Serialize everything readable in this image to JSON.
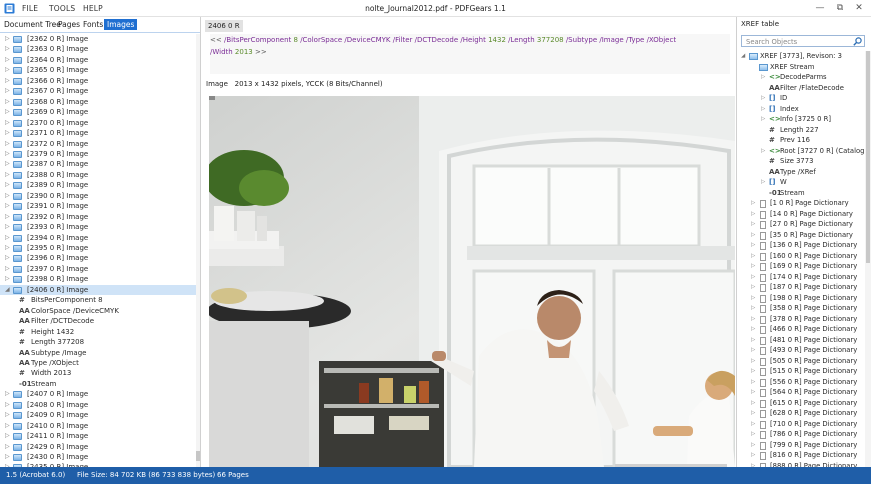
{
  "window": {
    "title": "nolte_Journal2012.pdf - PDFGears 1.1",
    "menus": [
      "FILE",
      "TOOLS",
      "HELP"
    ]
  },
  "left": {
    "tabs": [
      "Document Tree",
      "Pages",
      "Fonts",
      "Images"
    ],
    "rows": [
      {
        "label": "[2362 0 R] Image"
      },
      {
        "label": "[2363 0 R] Image"
      },
      {
        "label": "[2364 0 R] Image"
      },
      {
        "label": "[2365 0 R] Image"
      },
      {
        "label": "[2366 0 R] Image"
      },
      {
        "label": "[2367 0 R] Image"
      },
      {
        "label": "[2368 0 R] Image"
      },
      {
        "label": "[2369 0 R] Image"
      },
      {
        "label": "[2370 0 R] Image"
      },
      {
        "label": "[2371 0 R] Image"
      },
      {
        "label": "[2372 0 R] Image"
      },
      {
        "label": "[2379 0 R] Image"
      },
      {
        "label": "[2387 0 R] Image"
      },
      {
        "label": "[2388 0 R] Image"
      },
      {
        "label": "[2389 0 R] Image"
      },
      {
        "label": "[2390 0 R] Image"
      },
      {
        "label": "[2391 0 R] Image"
      },
      {
        "label": "[2392 0 R] Image"
      },
      {
        "label": "[2393 0 R] Image"
      },
      {
        "label": "[2394 0 R] Image"
      },
      {
        "label": "[2395 0 R] Image"
      },
      {
        "label": "[2396 0 R] Image"
      },
      {
        "label": "[2397 0 R] Image"
      },
      {
        "label": "[2398 0 R] Image"
      },
      {
        "label": "[2406 0 R] Image",
        "selected": true,
        "expanded": true
      },
      {
        "label": "BitsPerComponent 8",
        "icon": "#",
        "sub": true
      },
      {
        "label": "ColorSpace /DeviceCMYK",
        "icon": "AA",
        "sub": true
      },
      {
        "label": "Filter /DCTDecode",
        "icon": "AA",
        "sub": true
      },
      {
        "label": "Height 1432",
        "icon": "#",
        "sub": true
      },
      {
        "label": "Length 377208",
        "icon": "#",
        "sub": true
      },
      {
        "label": "Subtype /Image",
        "icon": "AA",
        "sub": true
      },
      {
        "label": "Type /XObject",
        "icon": "AA",
        "sub": true
      },
      {
        "label": "Width 2013",
        "icon": "#",
        "sub": true
      },
      {
        "label": "Stream",
        "icon": "-01",
        "sub": true
      },
      {
        "label": "[2407 0 R] Image"
      },
      {
        "label": "[2408 0 R] Image"
      },
      {
        "label": "[2409 0 R] Image"
      },
      {
        "label": "[2410 0 R] Image"
      },
      {
        "label": "[2411 0 R] Image"
      },
      {
        "label": "[2429 0 R] Image"
      },
      {
        "label": "[2430 0 R] Image"
      },
      {
        "label": "[2435 0 R] Image"
      }
    ]
  },
  "main": {
    "tab": "2406 0 R",
    "dict_parts": [
      {
        "t": "<< ",
        "c": "p"
      },
      {
        "t": "/BitsPerComponent ",
        "c": "k"
      },
      {
        "t": "8 ",
        "c": "n"
      },
      {
        "t": "/ColorSpace ",
        "c": "k"
      },
      {
        "t": "/DeviceCMYK ",
        "c": "k"
      },
      {
        "t": "/Filter ",
        "c": "k"
      },
      {
        "t": "/DCTDecode ",
        "c": "k"
      },
      {
        "t": "/Height ",
        "c": "k"
      },
      {
        "t": "1432 ",
        "c": "n"
      },
      {
        "t": "/Length ",
        "c": "k"
      },
      {
        "t": "377208 ",
        "c": "n"
      },
      {
        "t": "/Subtype ",
        "c": "k"
      },
      {
        "t": "/Image ",
        "c": "k"
      },
      {
        "t": "/Type ",
        "c": "k"
      },
      {
        "t": "/XObject",
        "c": "k"
      },
      {
        "t": "BR"
      },
      {
        "t": "/Width ",
        "c": "k"
      },
      {
        "t": "2013 ",
        "c": "n"
      },
      {
        "t": ">>",
        "c": "p"
      }
    ],
    "image_info_label": "Image",
    "image_info": "2013 x 1432 pixels, YCCK (8 Bits/Channel)"
  },
  "right": {
    "title": "XREF table",
    "search_placeholder": "Search Objects",
    "rows": [
      {
        "label": "XREF [3773], Revison: 3",
        "ind": 0,
        "icon": "table",
        "exp": "◢"
      },
      {
        "label": "XREF Stream",
        "ind": 1,
        "icon": "table"
      },
      {
        "label": "DecodeParms",
        "ind": 2,
        "icon": "<>",
        "exp": "▷"
      },
      {
        "label": "Filter /FlateDecode",
        "ind": 2,
        "icon": "AA"
      },
      {
        "label": "ID",
        "ind": 2,
        "icon": "[]",
        "exp": "▷"
      },
      {
        "label": "Index",
        "ind": 2,
        "icon": "[]",
        "exp": "▷"
      },
      {
        "label": "Info [3725 0 R]",
        "ind": 2,
        "icon": "<>",
        "exp": "▷"
      },
      {
        "label": "Length 227",
        "ind": 2,
        "icon": "#"
      },
      {
        "label": "Prev 116",
        "ind": 2,
        "icon": "#"
      },
      {
        "label": "Root [3727 0 R]  (Catalog)",
        "ind": 2,
        "icon": "<>",
        "exp": "▷"
      },
      {
        "label": "Size 3773",
        "ind": 2,
        "icon": "#"
      },
      {
        "label": "Type /XRef",
        "ind": 2,
        "icon": "AA"
      },
      {
        "label": "W",
        "ind": 2,
        "icon": "[]",
        "exp": "▷"
      },
      {
        "label": "Stream",
        "ind": 2,
        "icon": "-01"
      },
      {
        "label": "[1 0 R] Page Dictionary",
        "ind": 1,
        "icon": "page",
        "exp": "▷"
      },
      {
        "label": "[14 0 R] Page Dictionary",
        "ind": 1,
        "icon": "page",
        "exp": "▷"
      },
      {
        "label": "[27 0 R] Page Dictionary",
        "ind": 1,
        "icon": "page",
        "exp": "▷"
      },
      {
        "label": "[35 0 R] Page Dictionary",
        "ind": 1,
        "icon": "page",
        "exp": "▷"
      },
      {
        "label": "[136 0 R] Page Dictionary",
        "ind": 1,
        "icon": "page",
        "exp": "▷"
      },
      {
        "label": "[160 0 R] Page Dictionary",
        "ind": 1,
        "icon": "page",
        "exp": "▷"
      },
      {
        "label": "[169 0 R] Page Dictionary",
        "ind": 1,
        "icon": "page",
        "exp": "▷"
      },
      {
        "label": "[174 0 R] Page Dictionary",
        "ind": 1,
        "icon": "page",
        "exp": "▷"
      },
      {
        "label": "[187 0 R] Page Dictionary",
        "ind": 1,
        "icon": "page",
        "exp": "▷"
      },
      {
        "label": "[198 0 R] Page Dictionary",
        "ind": 1,
        "icon": "page",
        "exp": "▷"
      },
      {
        "label": "[358 0 R] Page Dictionary",
        "ind": 1,
        "icon": "page",
        "exp": "▷"
      },
      {
        "label": "[378 0 R] Page Dictionary",
        "ind": 1,
        "icon": "page",
        "exp": "▷"
      },
      {
        "label": "[466 0 R] Page Dictionary",
        "ind": 1,
        "icon": "page",
        "exp": "▷"
      },
      {
        "label": "[481 0 R] Page Dictionary",
        "ind": 1,
        "icon": "page",
        "exp": "▷"
      },
      {
        "label": "[493 0 R] Page Dictionary",
        "ind": 1,
        "icon": "page",
        "exp": "▷"
      },
      {
        "label": "[505 0 R] Page Dictionary",
        "ind": 1,
        "icon": "page",
        "exp": "▷"
      },
      {
        "label": "[515 0 R] Page Dictionary",
        "ind": 1,
        "icon": "page",
        "exp": "▷"
      },
      {
        "label": "[556 0 R] Page Dictionary",
        "ind": 1,
        "icon": "page",
        "exp": "▷"
      },
      {
        "label": "[564 0 R] Page Dictionary",
        "ind": 1,
        "icon": "page",
        "exp": "▷"
      },
      {
        "label": "[615 0 R] Page Dictionary",
        "ind": 1,
        "icon": "page",
        "exp": "▷"
      },
      {
        "label": "[628 0 R] Page Dictionary",
        "ind": 1,
        "icon": "page",
        "exp": "▷"
      },
      {
        "label": "[710 0 R] Page Dictionary",
        "ind": 1,
        "icon": "page",
        "exp": "▷"
      },
      {
        "label": "[786 0 R] Page Dictionary",
        "ind": 1,
        "icon": "page",
        "exp": "▷"
      },
      {
        "label": "[799 0 R] Page Dictionary",
        "ind": 1,
        "icon": "page",
        "exp": "▷"
      },
      {
        "label": "[816 0 R] Page Dictionary",
        "ind": 1,
        "icon": "page",
        "exp": "▷"
      },
      {
        "label": "[888 0 R] Page Dictionary",
        "ind": 1,
        "icon": "page",
        "exp": "▷"
      }
    ]
  },
  "status": {
    "version": "1.5 (Acrobat 6.0)",
    "file_size": "File Size: 84 702  KB (86 733 838  bytes)",
    "pages": "66 Pages"
  },
  "colors": {
    "accent": "#1f6fd1",
    "status_bar": "#1f5ea8",
    "dict_key": "#7a2c96",
    "dict_number": "#5a8a2a"
  }
}
